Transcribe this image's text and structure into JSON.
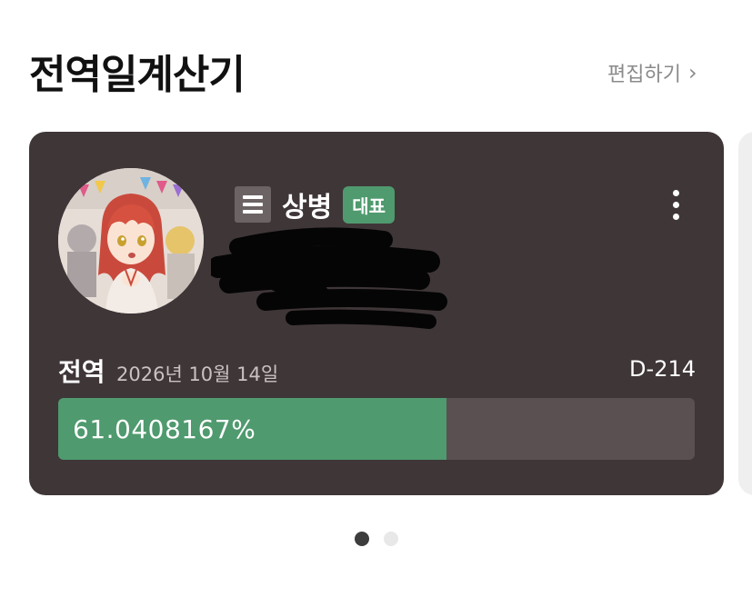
{
  "header": {
    "title": "전역일계산기",
    "edit_label": "편집하기",
    "chevron_glyph": "›"
  },
  "card": {
    "rank": "상병",
    "badge": "대표",
    "service": {
      "label": "전역",
      "date": "2026년 10월 14일",
      "dday": "D-214"
    },
    "progress": {
      "text": "61.0408167%",
      "value": 0.610408167
    }
  },
  "pager": {
    "count": 2,
    "active_index": 0
  },
  "colors": {
    "card_bg": "#3f3638",
    "accent_green": "#4f9a6e",
    "progress_track": "#5a5052"
  }
}
